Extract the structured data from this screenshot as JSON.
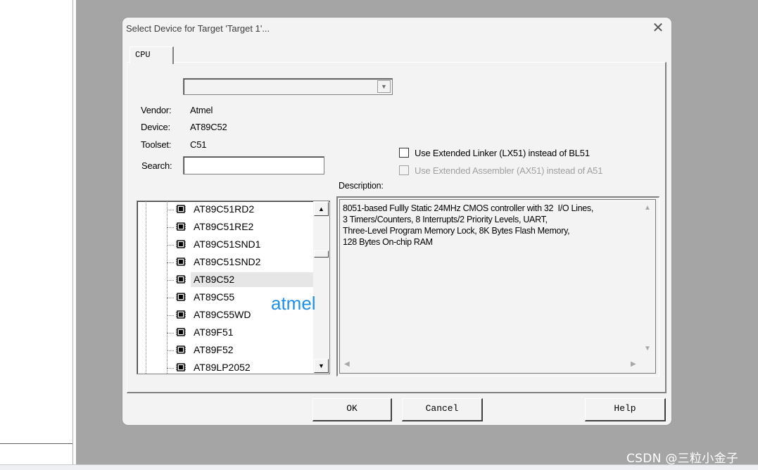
{
  "dialog": {
    "title": "Select Device for Target 'Target 1'...",
    "tab_label": "CPU"
  },
  "device_info": {
    "vendor_label": "Vendor:",
    "vendor_value": "Atmel",
    "device_label": "Device:",
    "device_value": "AT89C52",
    "toolset_label": "Toolset:",
    "toolset_value": "C51",
    "search_label": "Search:",
    "search_value": "",
    "database_combo_value": ""
  },
  "options": {
    "extended_linker_label": "Use Extended Linker (LX51) instead of BL51",
    "extended_linker_checked": false,
    "extended_assembler_label": "Use Extended Assembler (AX51) instead of A51",
    "extended_assembler_checked": false,
    "extended_assembler_enabled": false
  },
  "description": {
    "label": "Description:",
    "text": "8051-based Fullly Static 24MHz CMOS controller with 32  I/O Lines,\n3 Timers/Counters, 8 Interrupts/2 Priority Levels, UART,\nThree-Level Program Memory Lock, 8K Bytes Flash Memory,\n128 Bytes On-chip RAM"
  },
  "device_tree": {
    "items": [
      {
        "label": "AT89C51RD2"
      },
      {
        "label": "AT89C51RE2"
      },
      {
        "label": "AT89C51SND1"
      },
      {
        "label": "AT89C51SND2"
      },
      {
        "label": "AT89C52",
        "selected": true
      },
      {
        "label": "AT89C55"
      },
      {
        "label": "AT89C55WD"
      },
      {
        "label": "AT89F51"
      },
      {
        "label": "AT89F52"
      },
      {
        "label": "AT89LP2052"
      }
    ],
    "annotation": "atmel"
  },
  "buttons": {
    "ok": "OK",
    "cancel": "Cancel",
    "help": "Help"
  },
  "watermark": "CSDN @三粒小金子"
}
